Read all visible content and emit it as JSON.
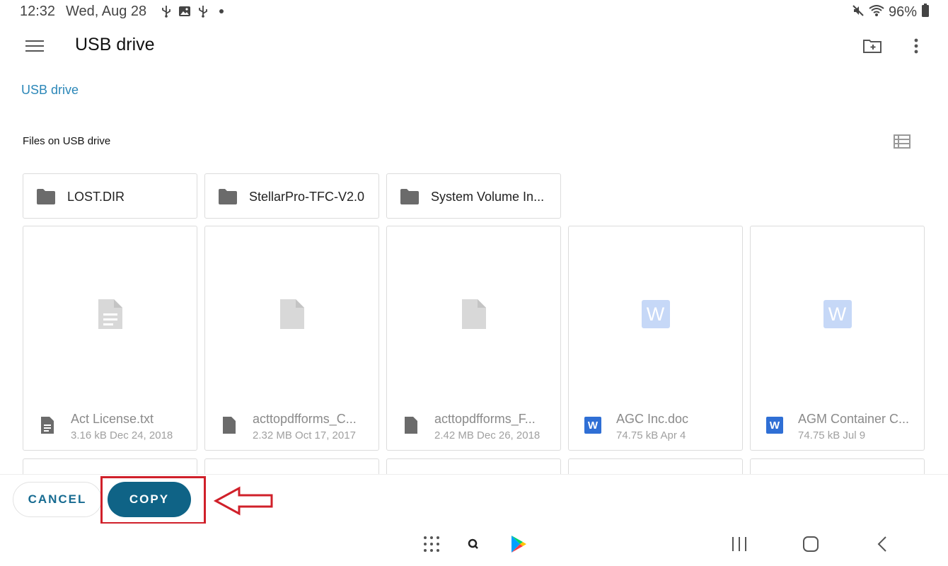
{
  "status_bar": {
    "time": "12:32",
    "date": "Wed, Aug 28",
    "battery": "96%",
    "left_icons": [
      "usb-icon",
      "image-icon",
      "usb-icon",
      "dot-icon"
    ],
    "right_icons": [
      "mute-icon",
      "wifi-icon",
      "battery-icon"
    ]
  },
  "app_bar": {
    "title": "USB drive",
    "menu_icon": "hamburger-menu-icon",
    "actions": [
      "new-folder-icon",
      "more-vert-icon"
    ]
  },
  "breadcrumb": "USB drive",
  "section_title": "Files on USB drive",
  "view_toggle_icon": "list-view-icon",
  "folders": [
    {
      "name": "LOST.DIR",
      "icon": "folder-icon"
    },
    {
      "name": "StellarPro-TFC-V2.0",
      "icon": "folder-icon"
    },
    {
      "name": "System Volume In...",
      "icon": "folder-icon"
    }
  ],
  "files": [
    {
      "name": "Act License.txt",
      "meta": "3.16 kB Dec 24, 2018",
      "type": "text"
    },
    {
      "name": "acttopdfforms_C...",
      "meta": "2.32 MB Oct 17, 2017",
      "type": "generic"
    },
    {
      "name": "acttopdfforms_F...",
      "meta": "2.42 MB Dec 26, 2018",
      "type": "generic"
    },
    {
      "name": "AGC Inc.doc",
      "meta": "74.75 kB Apr 4",
      "type": "word"
    },
    {
      "name": "AGM Container C...",
      "meta": "74.75 kB Jul 9",
      "type": "word"
    }
  ],
  "word_letter": "W",
  "actions": {
    "cancel": "CANCEL",
    "copy": "COPY"
  },
  "colors": {
    "accent": "#0f6386",
    "link": "#2b87b8",
    "highlight": "#d0202a"
  },
  "nav_bar": [
    "apps-grid-icon",
    "search-app-icon",
    "play-store-icon",
    "recents-icon",
    "home-icon",
    "back-icon"
  ]
}
